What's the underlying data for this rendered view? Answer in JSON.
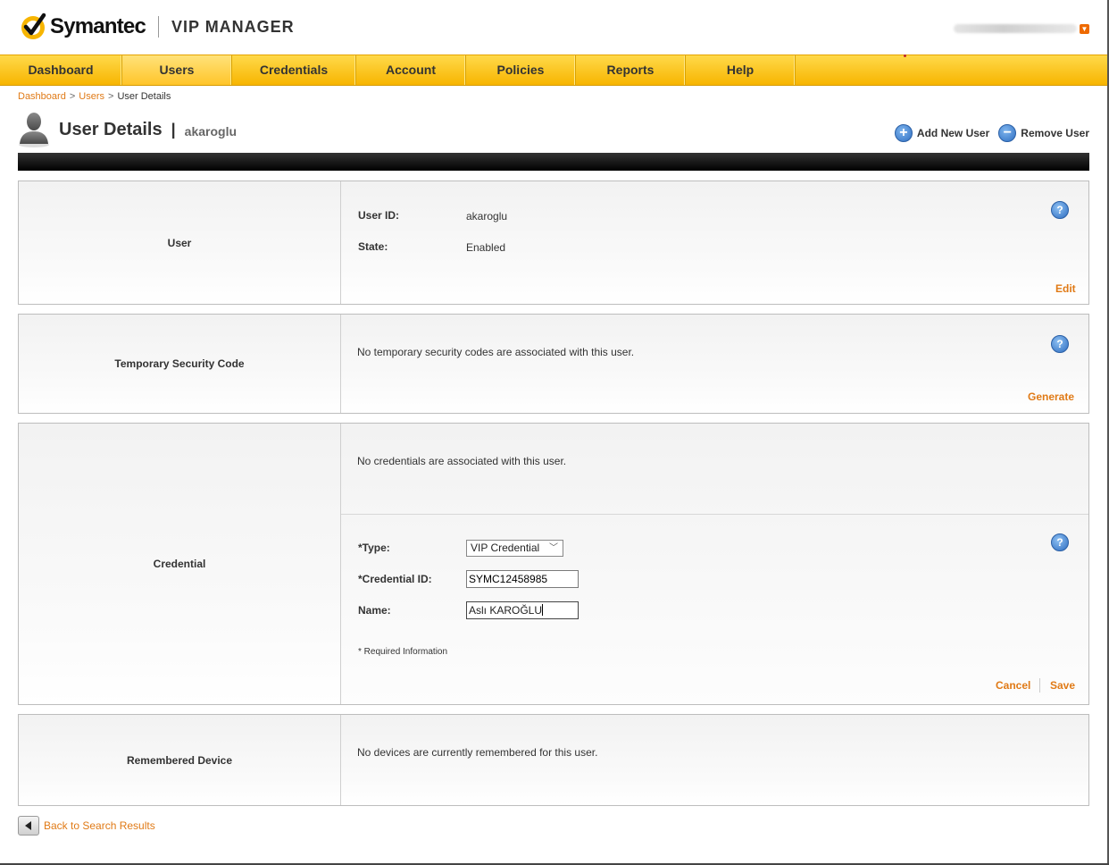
{
  "brand": {
    "company": "Symantec",
    "product": "VIP MANAGER",
    "accent": "#f7b500",
    "link_color": "#e07a16"
  },
  "header": {
    "user_menu_icon": "chevron-down-icon"
  },
  "nav": {
    "items": [
      {
        "label": "Dashboard"
      },
      {
        "label": "Users"
      },
      {
        "label": "Credentials"
      },
      {
        "label": "Account"
      },
      {
        "label": "Policies"
      },
      {
        "label": "Reports"
      },
      {
        "label": "Help"
      }
    ],
    "active": "Users"
  },
  "breadcrumb": {
    "items": [
      "Dashboard",
      "Users",
      "User Details"
    ],
    "separator": ">"
  },
  "page": {
    "title": "User Details",
    "title_separator": "|",
    "username": "akaroglu",
    "actions": {
      "add": "Add New User",
      "remove": "Remove User"
    }
  },
  "sections": {
    "user": {
      "label": "User",
      "user_id_label": "User ID:",
      "user_id": "akaroglu",
      "state_label": "State:",
      "state": "Enabled",
      "edit": "Edit"
    },
    "temp_code": {
      "label": "Temporary Security Code",
      "message": "No temporary security codes are associated with this user.",
      "generate": "Generate"
    },
    "credential": {
      "label": "Credential",
      "message": "No credentials are associated with this user.",
      "type_label": "*Type:",
      "type_value": "VIP Credential",
      "id_label": "*Credential ID:",
      "id_value": "SYMC12458985",
      "name_label": "Name:",
      "name_value": "Aslı KAROĞLU",
      "required_note": "* Required Information",
      "cancel": "Cancel",
      "save": "Save"
    },
    "device": {
      "label": "Remembered Device",
      "message": "No devices are currently remembered for this user."
    }
  },
  "footer": {
    "back": "Back to Search Results"
  }
}
